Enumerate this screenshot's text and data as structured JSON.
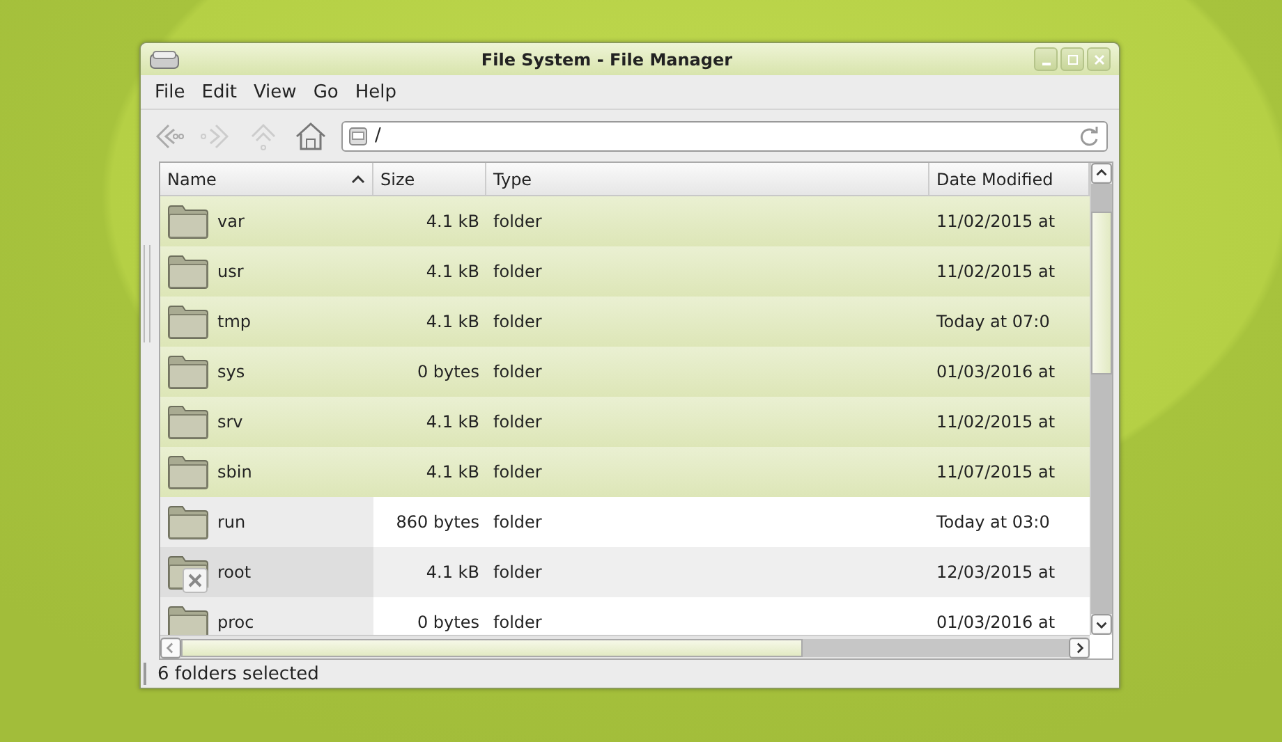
{
  "window": {
    "title": "File System - File Manager"
  },
  "menu": [
    "File",
    "Edit",
    "View",
    "Go",
    "Help"
  ],
  "location": {
    "value": "/"
  },
  "table": {
    "columns": [
      {
        "label": "Name",
        "sorted": true
      },
      {
        "label": "Size",
        "sorted": false
      },
      {
        "label": "Type",
        "sorted": false
      },
      {
        "label": "Date Modified",
        "sorted": false
      }
    ],
    "rows": [
      {
        "name": "var",
        "size": "4.1 kB",
        "type": "folder",
        "date": "11/02/2015 at",
        "selected": true,
        "unreadable": false
      },
      {
        "name": "usr",
        "size": "4.1 kB",
        "type": "folder",
        "date": "11/02/2015 at",
        "selected": true,
        "unreadable": false
      },
      {
        "name": "tmp",
        "size": "4.1 kB",
        "type": "folder",
        "date": "Today at 07:0",
        "selected": true,
        "unreadable": false
      },
      {
        "name": "sys",
        "size": "0 bytes",
        "type": "folder",
        "date": "01/03/2016 at",
        "selected": true,
        "unreadable": false
      },
      {
        "name": "srv",
        "size": "4.1 kB",
        "type": "folder",
        "date": "11/02/2015 at",
        "selected": true,
        "unreadable": false
      },
      {
        "name": "sbin",
        "size": "4.1 kB",
        "type": "folder",
        "date": "11/07/2015 at",
        "selected": true,
        "unreadable": false
      },
      {
        "name": "run",
        "size": "860 bytes",
        "type": "folder",
        "date": "Today at 03:0",
        "selected": false,
        "unreadable": false
      },
      {
        "name": "root",
        "size": "4.1 kB",
        "type": "folder",
        "date": "12/03/2015 at",
        "selected": false,
        "unreadable": true
      },
      {
        "name": "proc",
        "size": "0 bytes",
        "type": "folder",
        "date": "01/03/2016 at",
        "selected": false,
        "unreadable": false
      }
    ]
  },
  "status_bar": "6 folders selected"
}
